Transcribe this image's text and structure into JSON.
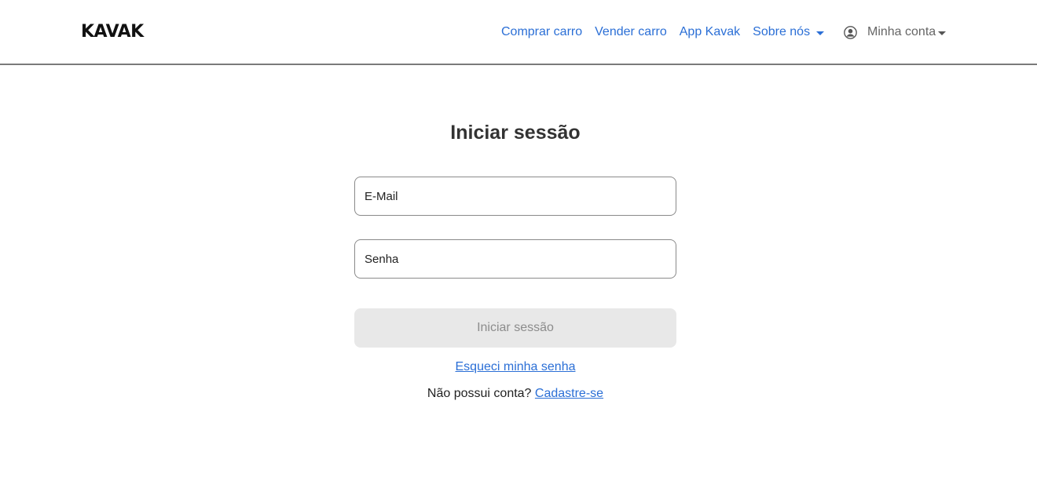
{
  "brand": {
    "logo_text": "KAVAK",
    "accent_color": "#2b6fd6"
  },
  "nav": {
    "items": [
      {
        "label": "Comprar carro"
      },
      {
        "label": "Vender carro"
      },
      {
        "label": "App Kavak"
      },
      {
        "label": "Sobre nós"
      }
    ],
    "account": {
      "icon": "user-circle-icon",
      "label": "Minha conta"
    }
  },
  "login": {
    "title": "Iniciar sessão",
    "email_placeholder": "E-Mail",
    "password_placeholder": "Senha",
    "submit_label": "Iniciar sessão",
    "forgot_label": "Esqueci minha senha",
    "no_account_text": "Não possui conta?",
    "signup_label": "Cadastre-se"
  }
}
